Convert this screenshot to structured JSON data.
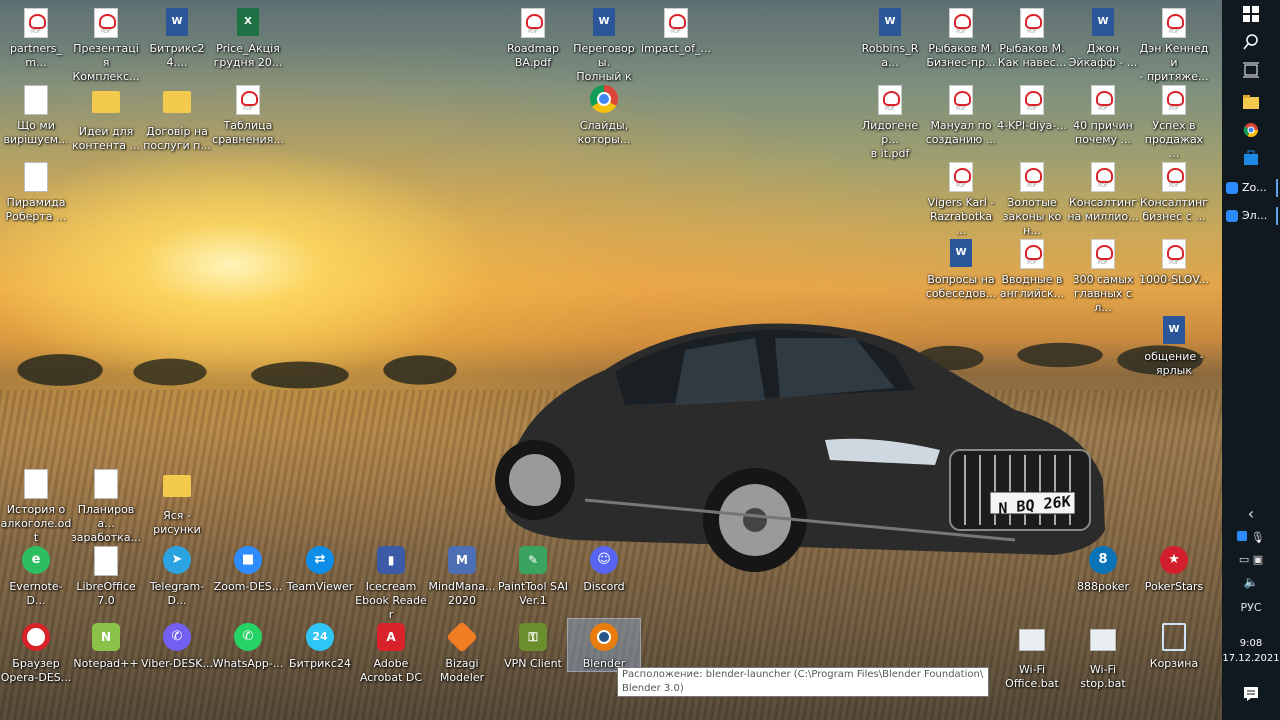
{
  "desktop": {
    "icons": [
      {
        "label": "partners_m...",
        "type": "pdf"
      },
      {
        "label": "Презентація\nКомплекс...",
        "type": "pdf"
      },
      {
        "label": "Битрикс24....",
        "type": "word"
      },
      {
        "label": "Price_Акція\nгрудня 20...",
        "type": "xls"
      },
      {
        "label": "Roadmap\nBA.pdf",
        "type": "pdf"
      },
      {
        "label": "Переговоры.\nПолный ку...",
        "type": "word"
      },
      {
        "label": "impact_of_...",
        "type": "pdf"
      },
      {
        "label": "Robbins_Ra...",
        "type": "word"
      },
      {
        "label": "Рыбаков М.\nБизнес-пр...",
        "type": "pdf"
      },
      {
        "label": "Рыбаков М.\nКак навес...",
        "type": "pdf"
      },
      {
        "label": "Джон\nЭйкафф - ...",
        "type": "word"
      },
      {
        "label": "Дэн Кеннеди\n- притяже...",
        "type": "pdf"
      },
      {
        "label": "Що ми\nвирішуєм...",
        "type": "doc"
      },
      {
        "label": "Идеи для\nконтента ...",
        "type": "folder"
      },
      {
        "label": "Договір на\nпослуги п...",
        "type": "folder"
      },
      {
        "label": "Таблица\nсравнения...",
        "type": "pdf"
      },
      {
        "label": "Слайды,\nкоторы...",
        "type": "chrome"
      },
      {
        "label": "Лидогенер...\nв it.pdf",
        "type": "pdf"
      },
      {
        "label": "Мануал по\nсозданию ...",
        "type": "pdf"
      },
      {
        "label": "4-KPI-diya-...",
        "type": "pdf"
      },
      {
        "label": "40 причин\nпочему ...",
        "type": "pdf"
      },
      {
        "label": "Успех в\nпродажах ...",
        "type": "pdf"
      },
      {
        "label": "Пирамида\nРоберта ...",
        "type": "doc"
      },
      {
        "label": "Vigers Karl -\nRazrabotka ...",
        "type": "pdf"
      },
      {
        "label": "Золотые\nзаконы кон...",
        "type": "pdf"
      },
      {
        "label": "Консалтинг\nна миллио...",
        "type": "pdf"
      },
      {
        "label": "Консалтинг\nбизнес с ...",
        "type": "pdf"
      },
      {
        "label": "Вопросы на\nсобеседов...",
        "type": "word"
      },
      {
        "label": "Вводные в\nанглийск...",
        "type": "pdf"
      },
      {
        "label": "300 самых\nглавных сл...",
        "type": "pdf"
      },
      {
        "label": "1000-SLOV...",
        "type": "pdf"
      },
      {
        "label": "общение -\nярлык",
        "type": "word"
      },
      {
        "label": "История о\nалкоголе.odt",
        "type": "doc"
      },
      {
        "label": "Планирова...\nзаработка...",
        "type": "doc"
      },
      {
        "label": "Яся -\nрисунки",
        "type": "folder"
      },
      {
        "label": "Evernote-D...",
        "type": "evernote"
      },
      {
        "label": "LibreOffice\n7.0",
        "type": "doc"
      },
      {
        "label": "Telegram-D...",
        "type": "telegram"
      },
      {
        "label": "Zoom-DES...",
        "type": "zoom"
      },
      {
        "label": "TeamViewer",
        "type": "teamviewer"
      },
      {
        "label": "Icecream\nEbook Reader",
        "type": "icecream"
      },
      {
        "label": "MindMana...\n2020",
        "type": "mindmanager"
      },
      {
        "label": "PaintTool SAI\nVer.1",
        "type": "painttool"
      },
      {
        "label": "Discord",
        "type": "discord"
      },
      {
        "label": "888poker",
        "type": "poker888"
      },
      {
        "label": "PokerStars",
        "type": "pokerstars"
      },
      {
        "label": "Браузер\nOpera-DES...",
        "type": "opera"
      },
      {
        "label": "Notepad++",
        "type": "notepad"
      },
      {
        "label": "Viber-DESK...",
        "type": "viber"
      },
      {
        "label": "WhatsApp-...",
        "type": "whatsapp"
      },
      {
        "label": "Битрикс24",
        "type": "bitrix"
      },
      {
        "label": "Adobe\nAcrobat DC",
        "type": "acrobat"
      },
      {
        "label": "Bizagi\nModeler",
        "type": "bizagi"
      },
      {
        "label": "VPN Client",
        "type": "vpn"
      },
      {
        "label": "Blender",
        "type": "blender"
      },
      {
        "label": "Wi-Fi\nOffice.bat",
        "type": "bat"
      },
      {
        "label": "Wi-Fi\nstop.bat",
        "type": "bat"
      },
      {
        "label": "Корзина",
        "type": "recycle"
      }
    ]
  },
  "car": {
    "plate": "N BQ 26K"
  },
  "tooltip": {
    "text": "Расположение: blender-launcher (C:\\Program Files\\Blender Foundation\\ Blender 3.0)"
  },
  "taskbar": {
    "apps": [
      {
        "label": "Zo..."
      },
      {
        "label": "Эл..."
      }
    ],
    "language": "РУС",
    "time": "9:08",
    "date": "17.12.2021"
  }
}
